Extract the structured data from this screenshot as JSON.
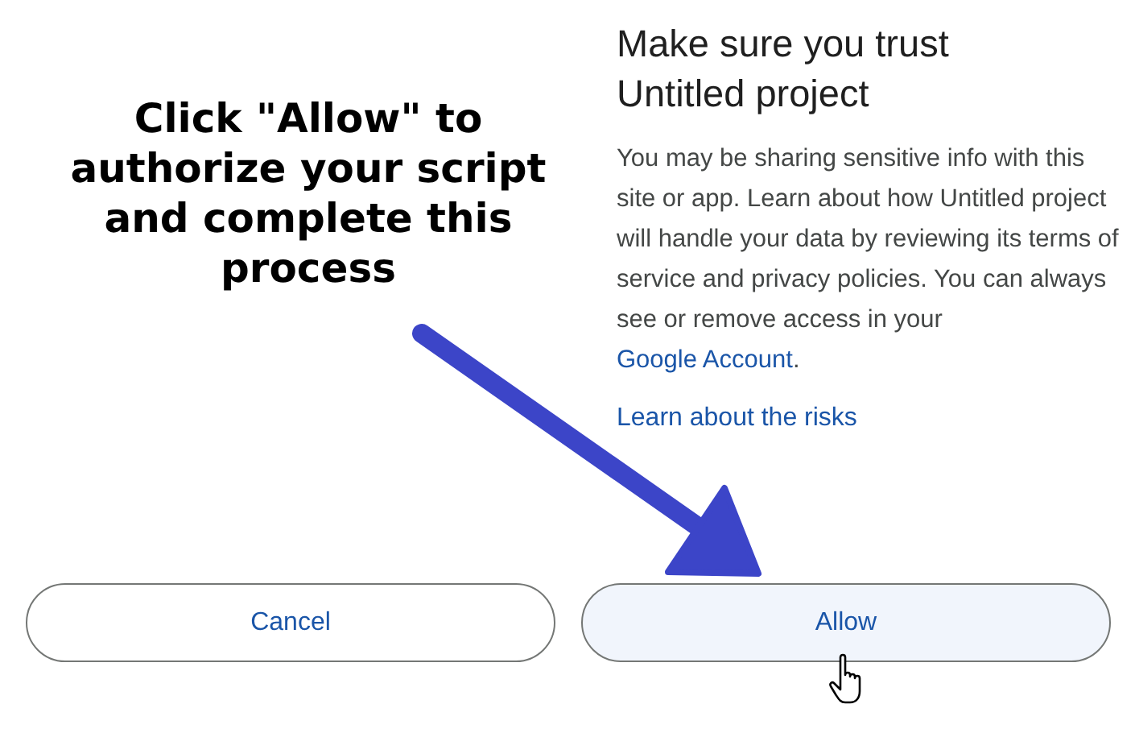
{
  "annotation": {
    "text": "Click \"Allow\" to authorize your script and complete this process"
  },
  "dialog": {
    "title": "Make sure you trust Untitled project",
    "body": "You may be sharing sensitive info with this site or app. Learn about how Untitled project will handle your data by reviewing its terms of service and privacy policies. You can always see or remove access in your",
    "account_link": "Google Account",
    "body_end": ".",
    "risks_link": "Learn about the risks"
  },
  "buttons": [
    {
      "label": "Cancel",
      "hovered": false
    },
    {
      "label": "Allow",
      "hovered": true
    }
  ]
}
